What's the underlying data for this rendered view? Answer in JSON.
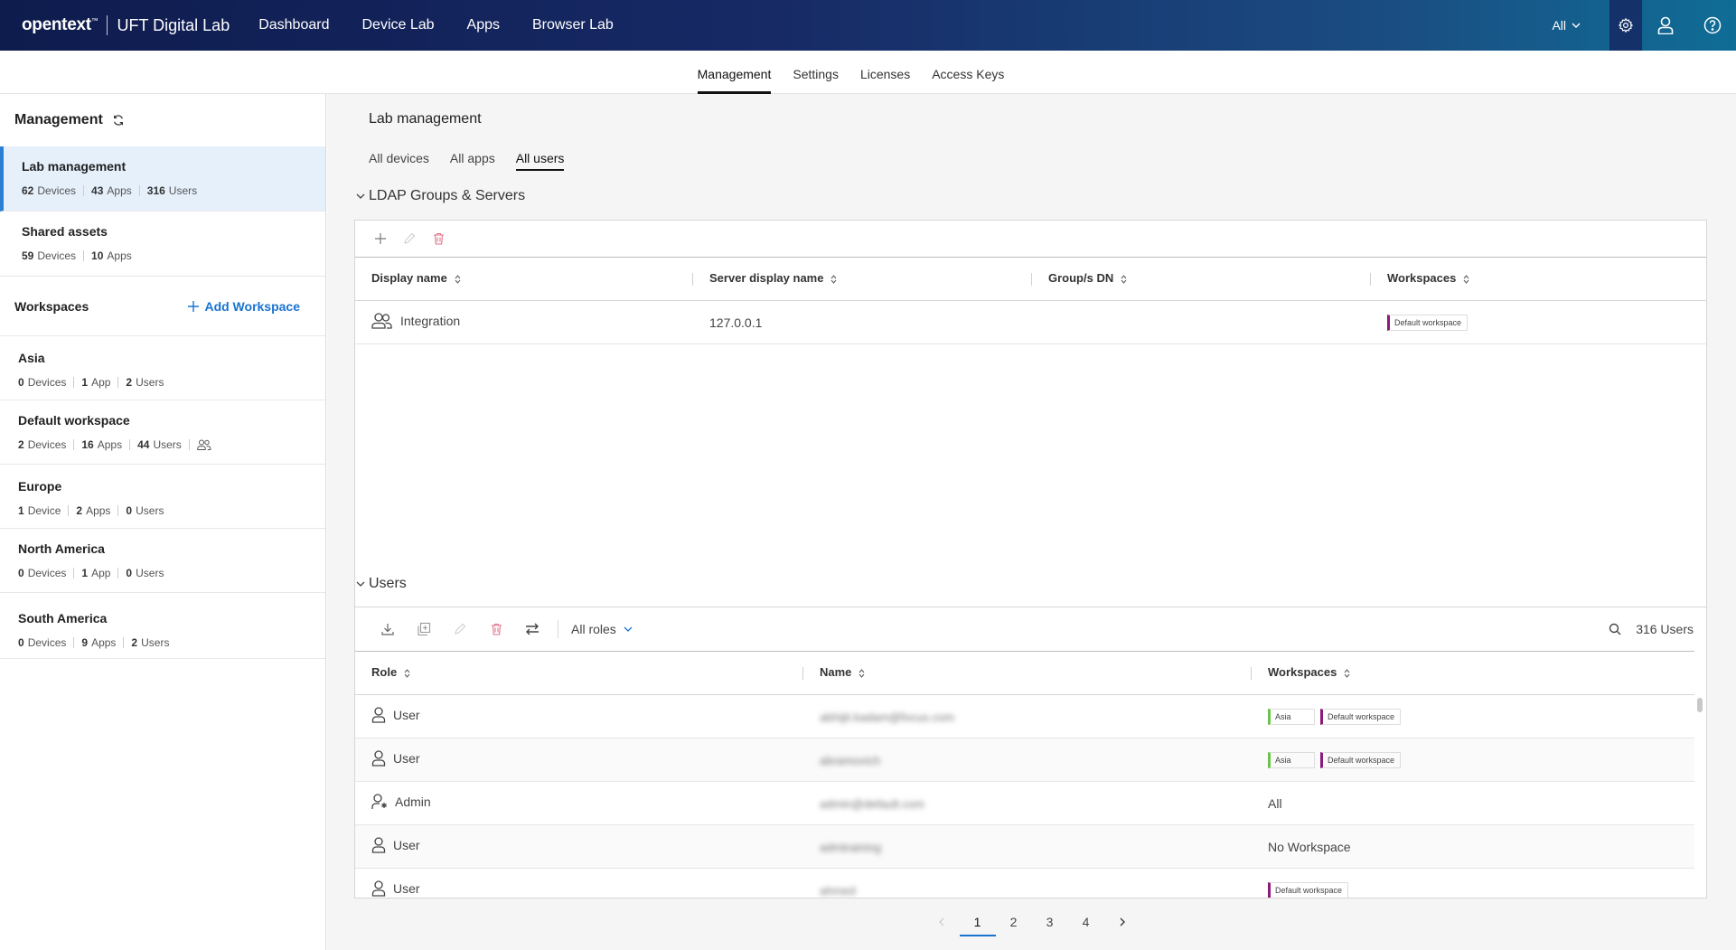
{
  "header": {
    "brand_logo": "opentext",
    "brand_tm": "™",
    "app_name": "UFT Digital Lab",
    "nav": [
      "Dashboard",
      "Device Lab",
      "Apps",
      "Browser Lab"
    ],
    "workspace_selector": "All"
  },
  "subnav": {
    "tabs": [
      "Management",
      "Settings",
      "Licenses",
      "Access Keys"
    ],
    "active": "Management"
  },
  "sidebar": {
    "title": "Management",
    "lab_management": {
      "name": "Lab management",
      "devices": "62",
      "devices_label": "Devices",
      "apps": "43",
      "apps_label": "Apps",
      "users": "316",
      "users_label": "Users"
    },
    "shared_assets": {
      "name": "Shared assets",
      "devices": "59",
      "devices_label": "Devices",
      "apps": "10",
      "apps_label": "Apps"
    },
    "workspaces_label": "Workspaces",
    "add_workspace": "Add Workspace",
    "workspaces": [
      {
        "name": "Asia",
        "devices": "0",
        "devices_label": "Devices",
        "apps": "1",
        "apps_label": "App",
        "users": "2",
        "users_label": "Users"
      },
      {
        "name": "Default workspace",
        "devices": "2",
        "devices_label": "Devices",
        "apps": "16",
        "apps_label": "Apps",
        "users": "44",
        "users_label": "Users"
      },
      {
        "name": "Europe",
        "devices": "1",
        "devices_label": "Device",
        "apps": "2",
        "apps_label": "Apps",
        "users": "0",
        "users_label": "Users"
      },
      {
        "name": "North America",
        "devices": "0",
        "devices_label": "Devices",
        "apps": "1",
        "apps_label": "App",
        "users": "0",
        "users_label": "Users"
      },
      {
        "name": "South America",
        "devices": "0",
        "devices_label": "Devices",
        "apps": "9",
        "apps_label": "Apps",
        "users": "2",
        "users_label": "Users"
      }
    ]
  },
  "main": {
    "title": "Lab management",
    "tabs": [
      "All devices",
      "All apps",
      "All users"
    ],
    "active_tab": "All users",
    "ldap": {
      "section_title": "LDAP Groups & Servers",
      "columns": [
        "Display name",
        "Server display name",
        "Group/s DN",
        "Workspaces"
      ],
      "rows": [
        {
          "display_name": "Integration",
          "server": "127.0.0.1",
          "group_dn": "",
          "workspaces": [
            "Default workspace"
          ]
        }
      ]
    },
    "users": {
      "section_title": "Users",
      "roles_filter": "All roles",
      "count": "316 Users",
      "columns": [
        "Role",
        "Name",
        "Workspaces"
      ],
      "rows": [
        {
          "role": "User",
          "name": "abhijit.kadam@focus.com",
          "workspaces": [
            "Asia",
            "Default workspace"
          ],
          "ws_text": ""
        },
        {
          "role": "User",
          "name": "abramovich",
          "workspaces": [
            "Asia",
            "Default workspace"
          ],
          "ws_text": ""
        },
        {
          "role": "Admin",
          "name": "admin@default.com",
          "workspaces": [],
          "ws_text": "All"
        },
        {
          "role": "User",
          "name": "admtraining",
          "workspaces": [],
          "ws_text": "No Workspace"
        },
        {
          "role": "User",
          "name": "ahmed",
          "workspaces": [
            "Default workspace"
          ],
          "ws_text": ""
        }
      ]
    },
    "pagination": {
      "pages": [
        "1",
        "2",
        "3",
        "4"
      ],
      "current": "1"
    }
  },
  "colors": {
    "header_start": "#0e1b4d",
    "header_end": "#0f6d96",
    "accent": "#1a73d1",
    "tag_default": "#8c1a7a",
    "tag_asia": "#6cc24a",
    "delete": "#e0728a"
  }
}
